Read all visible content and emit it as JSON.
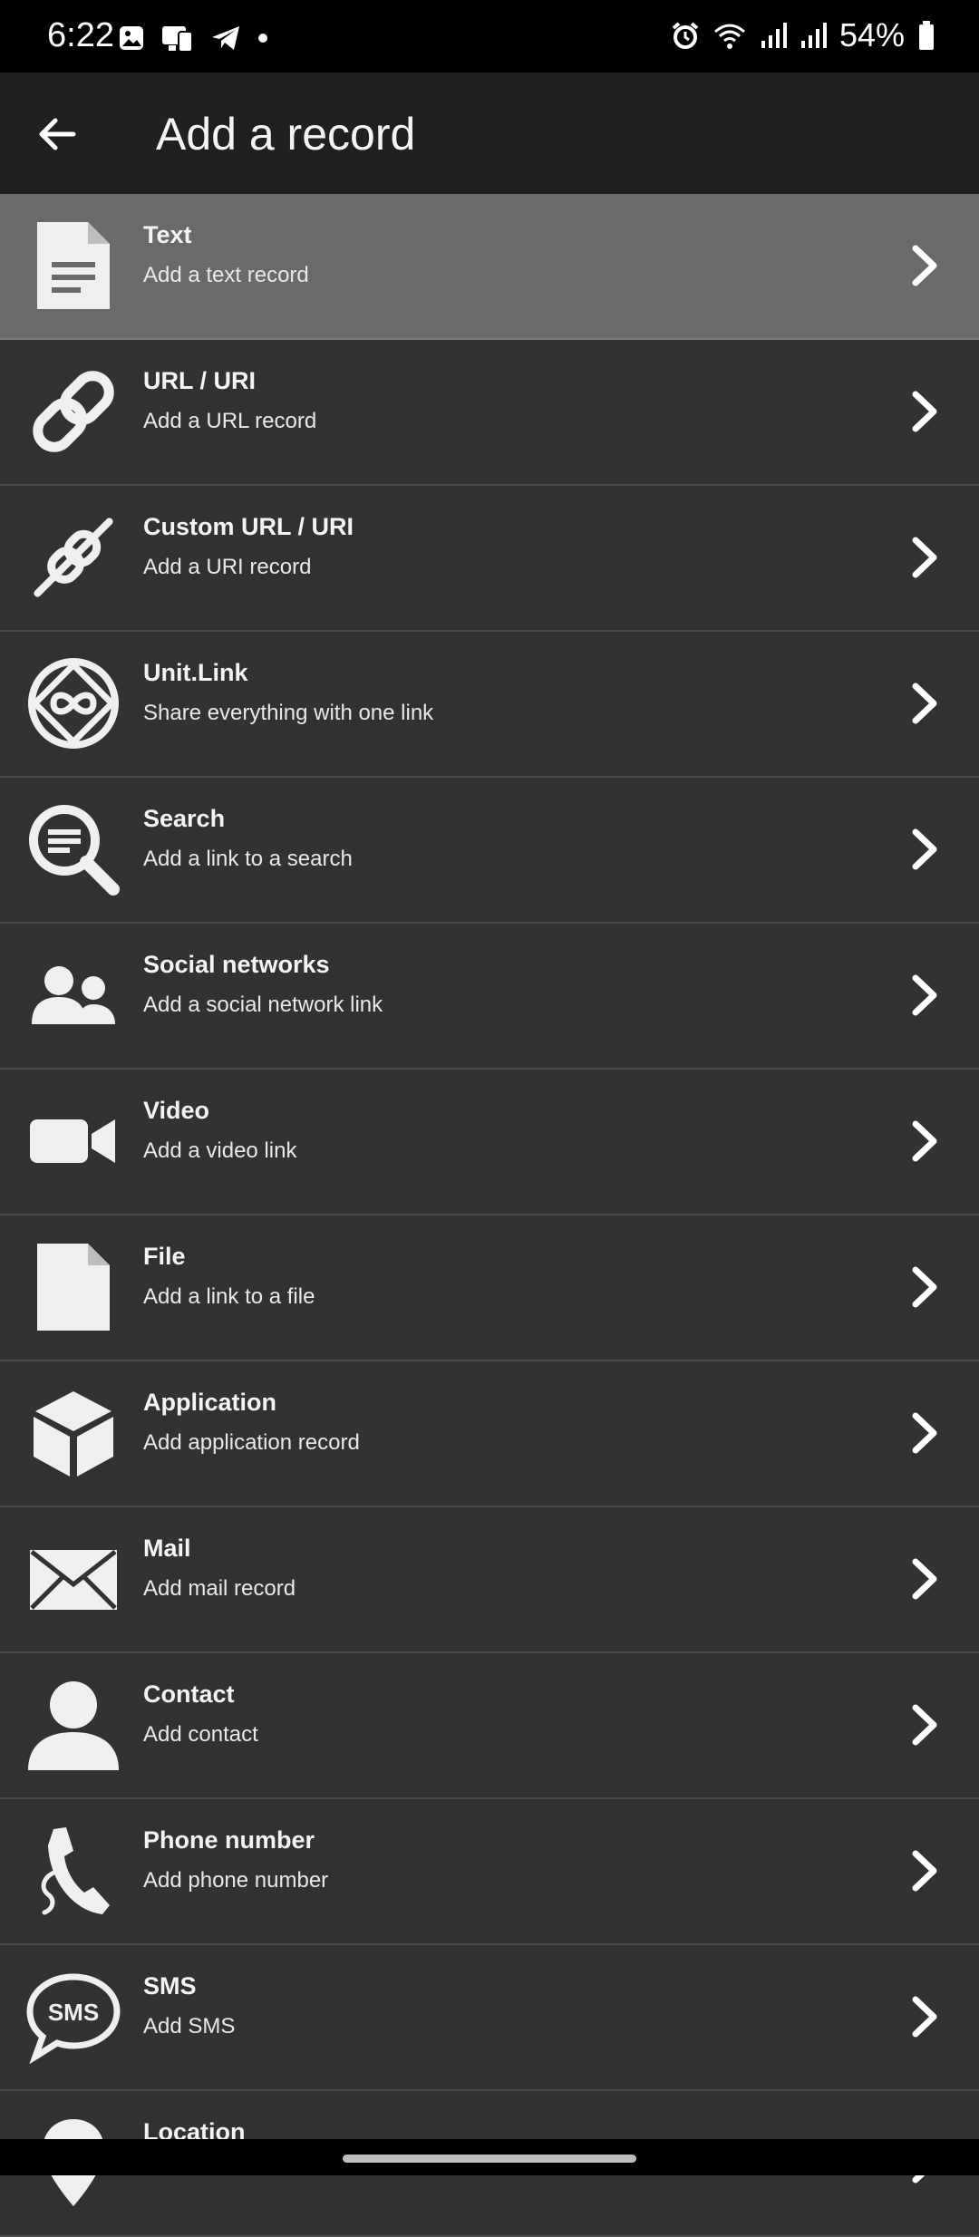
{
  "status_bar": {
    "time": "6:22",
    "battery": "54%"
  },
  "app_bar": {
    "title": "Add a record"
  },
  "items": [
    {
      "title": "Text",
      "subtitle": "Add a text record",
      "icon": "document-icon"
    },
    {
      "title": "URL / URI",
      "subtitle": "Add a URL record",
      "icon": "link-icon"
    },
    {
      "title": "Custom URL / URI",
      "subtitle": "Add a URI record",
      "icon": "custom-link-icon"
    },
    {
      "title": "Unit.Link",
      "subtitle": "Share everything with one link",
      "icon": "infinity-icon"
    },
    {
      "title": "Search",
      "subtitle": "Add a link to a search",
      "icon": "search-icon"
    },
    {
      "title": "Social networks",
      "subtitle": "Add a social network link",
      "icon": "people-icon"
    },
    {
      "title": "Video",
      "subtitle": "Add a video link",
      "icon": "video-camera-icon"
    },
    {
      "title": "File",
      "subtitle": "Add a link to a file",
      "icon": "file-icon"
    },
    {
      "title": "Application",
      "subtitle": "Add application record",
      "icon": "cube-icon"
    },
    {
      "title": "Mail",
      "subtitle": "Add mail record",
      "icon": "envelope-icon"
    },
    {
      "title": "Contact",
      "subtitle": "Add contact",
      "icon": "person-icon"
    },
    {
      "title": "Phone number",
      "subtitle": "Add phone number",
      "icon": "phone-icon"
    },
    {
      "title": "SMS",
      "subtitle": "Add SMS",
      "icon": "sms-icon",
      "icon_text": "SMS"
    },
    {
      "title": "Location",
      "subtitle": "",
      "icon": "location-pin-icon"
    }
  ]
}
